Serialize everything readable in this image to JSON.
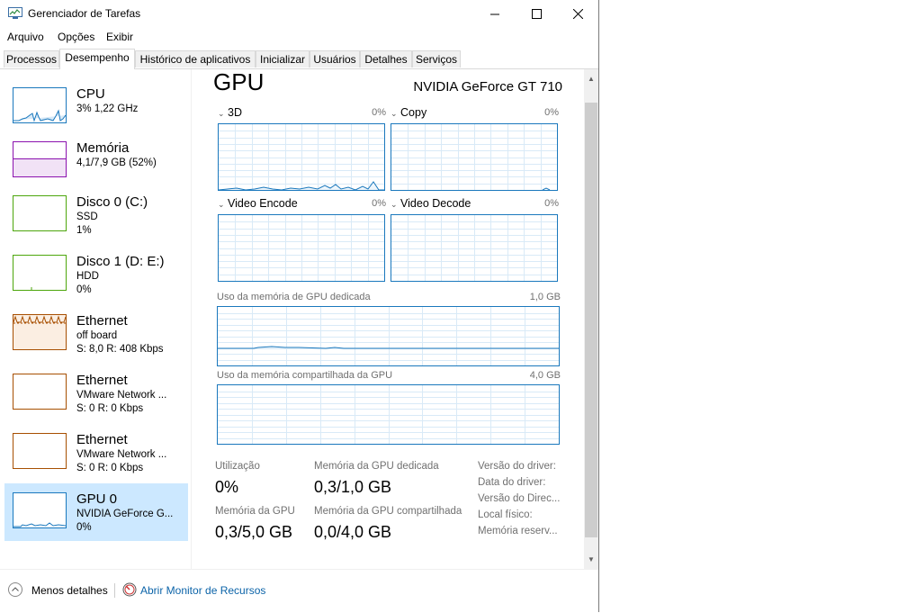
{
  "window": {
    "title": "Gerenciador de Tarefas"
  },
  "menu": [
    "Arquivo",
    "Opções",
    "Exibir"
  ],
  "tabs": [
    "Processos",
    "Desempenho",
    "Histórico de aplicativos",
    "Inicializar",
    "Usuários",
    "Detalhes",
    "Serviços"
  ],
  "active_tab": "Desempenho",
  "sidebar": {
    "items": [
      {
        "title": "CPU",
        "sub1": "3%  1,22 GHz",
        "sub2": "",
        "sub3": "",
        "color": "#1a78bd"
      },
      {
        "title": "Memória",
        "sub1": "4,1/7,9 GB (52%)",
        "sub2": "",
        "sub3": "",
        "color": "#8b12ae"
      },
      {
        "title": "Disco 0 (C:)",
        "sub1": "SSD",
        "sub2": "1%",
        "sub3": "",
        "color": "#4da60c"
      },
      {
        "title": "Disco 1 (D: E:)",
        "sub1": "HDD",
        "sub2": "0%",
        "sub3": "",
        "color": "#4da60c"
      },
      {
        "title": "Ethernet",
        "sub1": "off board",
        "sub2": "S: 8,0  R: 408 Kbps",
        "sub3": "",
        "color": "#a74f01"
      },
      {
        "title": "Ethernet",
        "sub1": "VMware Network ...",
        "sub2": "S: 0  R: 0 Kbps",
        "sub3": "",
        "color": "#a74f01"
      },
      {
        "title": "Ethernet",
        "sub1": "VMware Network ...",
        "sub2": "S: 0  R: 0 Kbps",
        "sub3": "",
        "color": "#a74f01"
      },
      {
        "title": "GPU 0",
        "sub1": "NVIDIA GeForce G...",
        "sub2": "0%",
        "sub3": "",
        "color": "#1a78bd"
      }
    ]
  },
  "main": {
    "title": "GPU",
    "device": "NVIDIA GeForce GT 710",
    "engines": [
      {
        "label": "3D",
        "value": "0%"
      },
      {
        "label": "Copy",
        "value": "0%"
      },
      {
        "label": "Video Encode",
        "value": "0%"
      },
      {
        "label": "Video Decode",
        "value": "0%"
      }
    ],
    "dedicated": {
      "label": "Uso da memória de GPU dedicada",
      "max": "1,0 GB"
    },
    "shared": {
      "label": "Uso da memória compartilhada da GPU",
      "max": "4,0 GB"
    },
    "stats": {
      "utilization_label": "Utilização",
      "utilization_value": "0%",
      "ded_label": "Memória da GPU dedicada",
      "ded_value": "0,3/1,0 GB",
      "gpumem_label": "Memória da GPU",
      "gpumem_value": "0,3/5,0 GB",
      "shared_label": "Memória da GPU compartilhada",
      "shared_value": "0,0/4,0 GB"
    },
    "driver": [
      "Versão do driver:",
      "Data do driver:",
      "Versão do Direc...",
      "Local físico:",
      "Memória reserv..."
    ]
  },
  "footer": {
    "fewer": "Menos detalhes",
    "monitor": "Abrir Monitor de Recursos"
  }
}
